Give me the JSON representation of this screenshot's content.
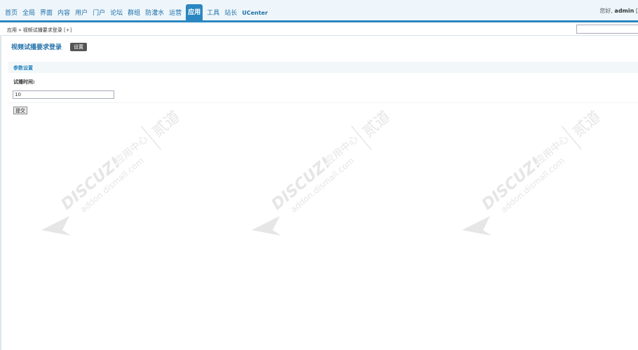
{
  "nav": {
    "items": [
      "首页",
      "全局",
      "界面",
      "内容",
      "用户",
      "门户",
      "论坛",
      "群组",
      "防灌水",
      "运营",
      "应用",
      "工具",
      "站长",
      "UCenter"
    ],
    "active_index": 10
  },
  "user": {
    "greeting": "您好,",
    "name": "admin",
    "bracket": "["
  },
  "breadcrumb": {
    "root": "应用",
    "sep": "»",
    "current": "视频试播要求登录",
    "plus": "[+]"
  },
  "search": {
    "value": ""
  },
  "page": {
    "title": "视频试播要求登录",
    "settings_label": "设置"
  },
  "section": {
    "title": "参数设置"
  },
  "field": {
    "label": "试播时间:",
    "value": "10"
  },
  "submit_label": "提交",
  "watermark": {
    "brand": "DISCUZ!",
    "cn": "应用中心",
    "site": "addon.dismall.com",
    "mark": "贰道"
  },
  "colors": {
    "accent": "#2b87c1",
    "nav_text": "#1f6fa8",
    "watermark": "#e6e6e6"
  }
}
